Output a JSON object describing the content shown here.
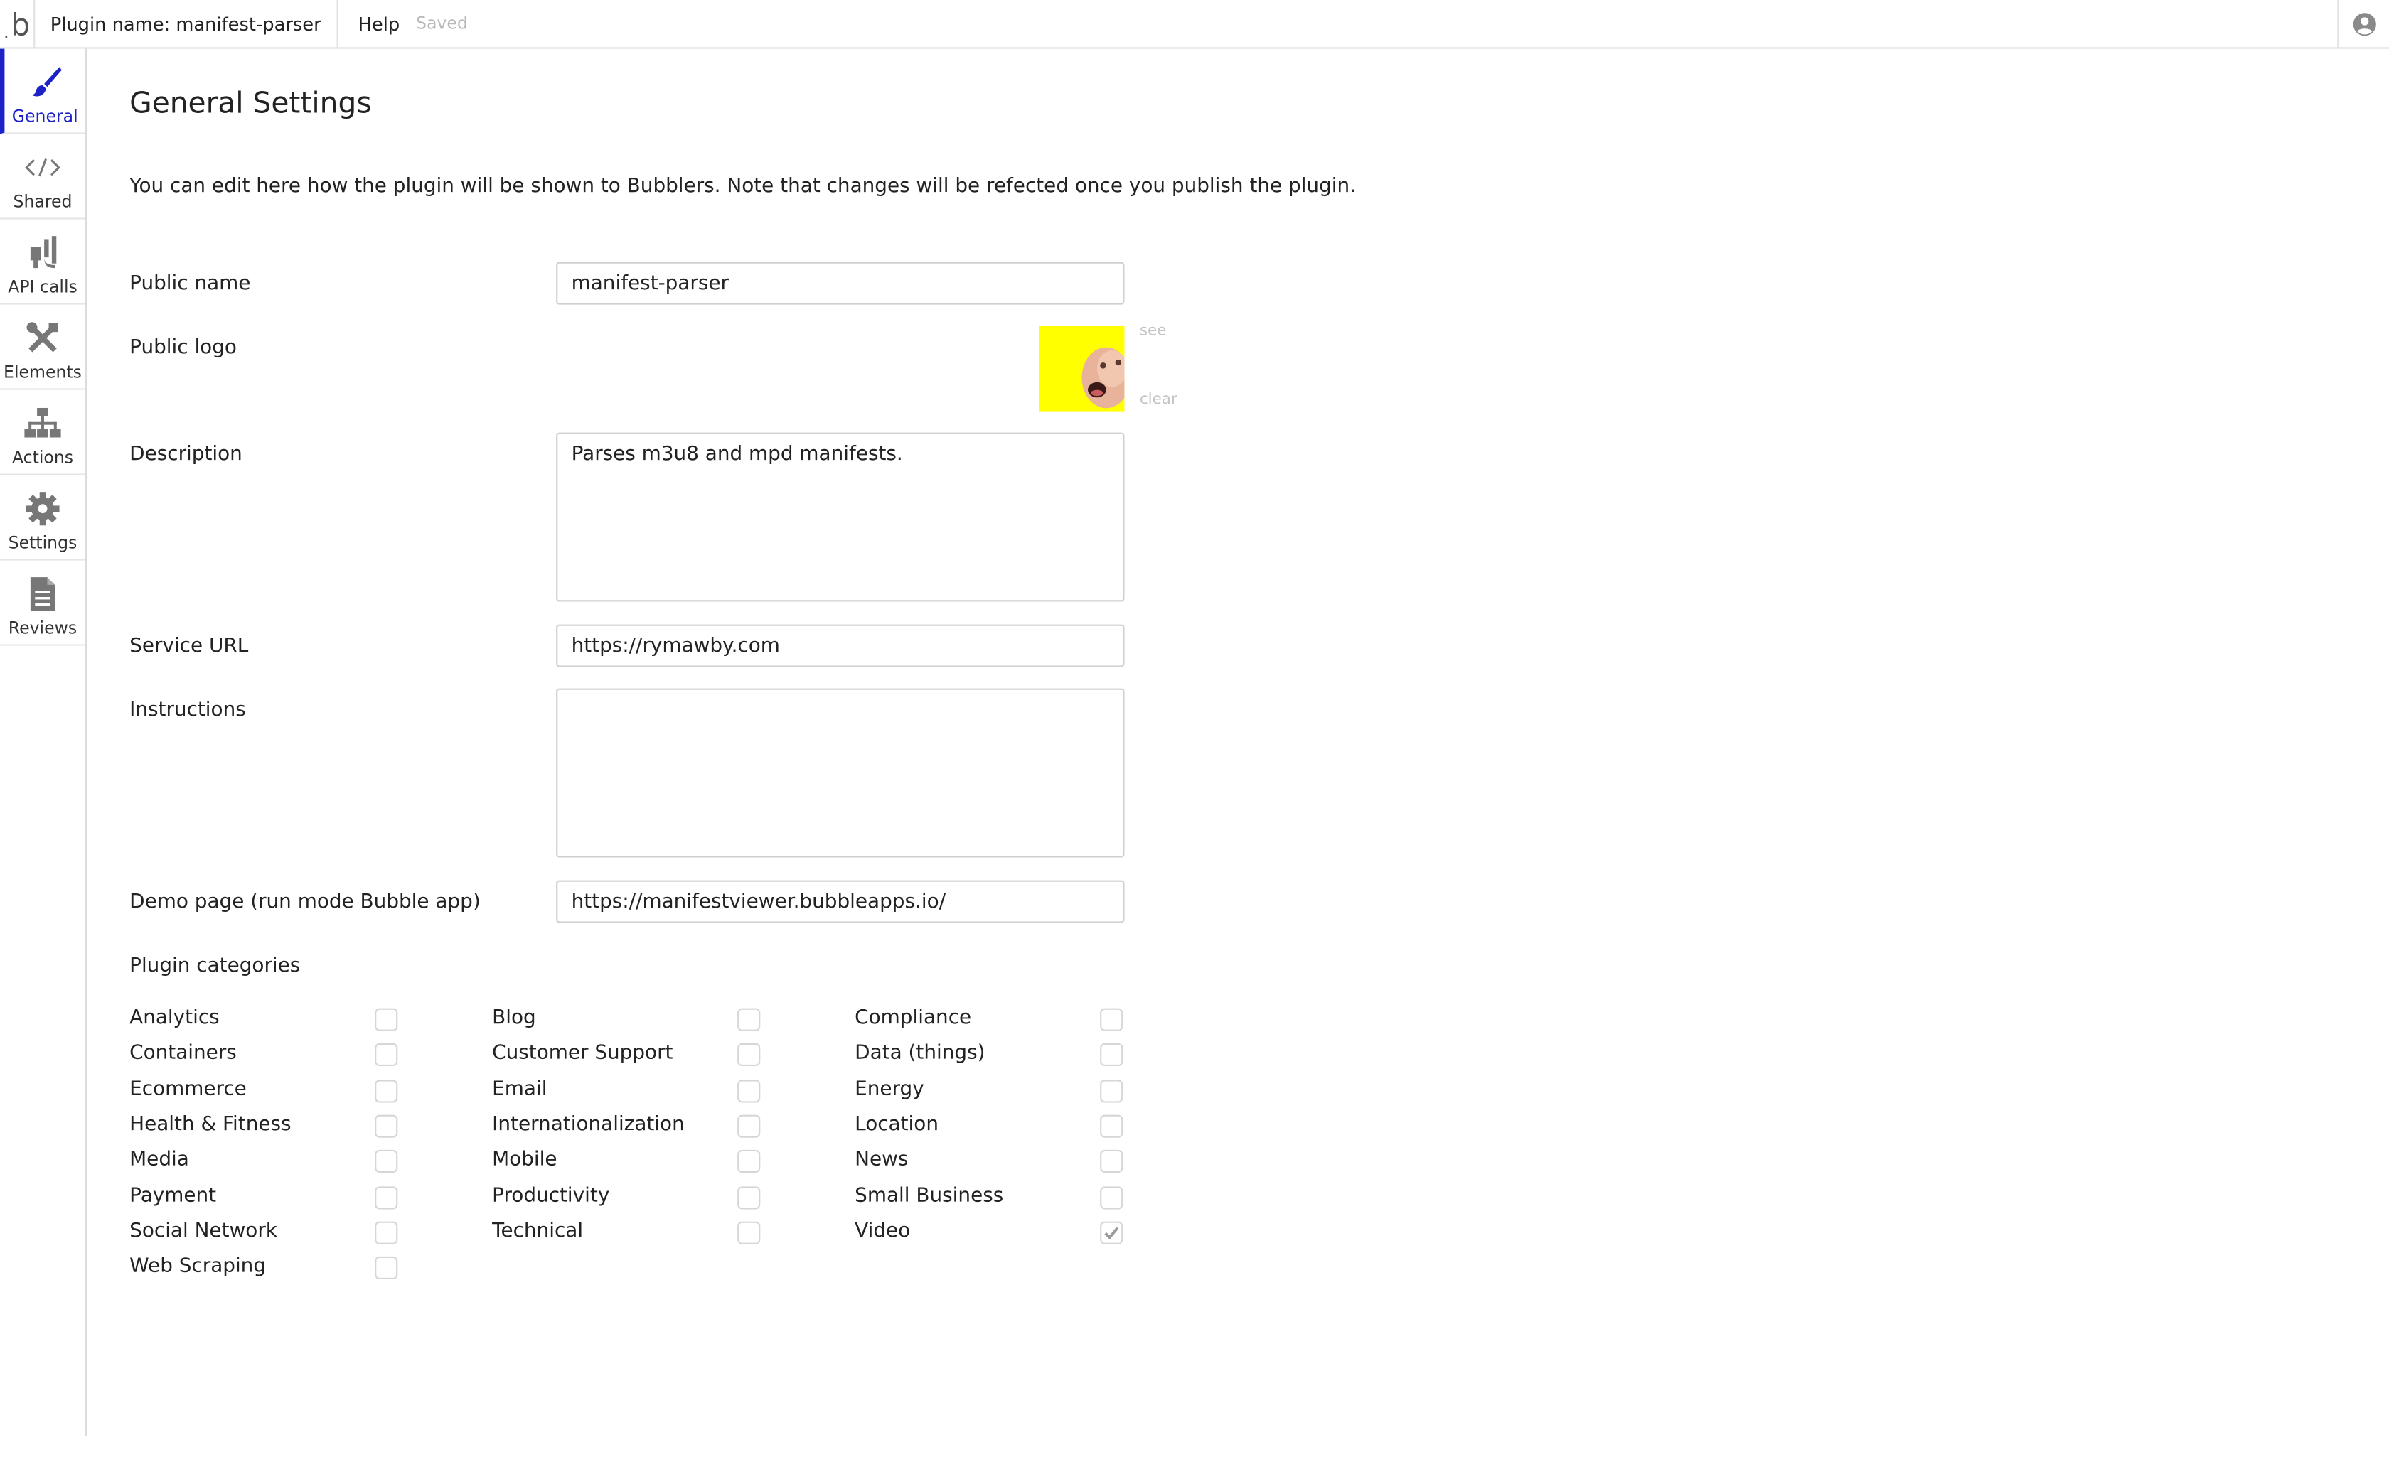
{
  "topbar": {
    "logo_text": "b",
    "plugin_name": "Plugin name: manifest-parser",
    "help": "Help",
    "status": "Saved"
  },
  "sidebar": {
    "items": [
      {
        "label": "General",
        "icon": "brush-icon",
        "active": true
      },
      {
        "label": "Shared",
        "icon": "code-icon",
        "active": false
      },
      {
        "label": "API calls",
        "icon": "plug-icon",
        "active": false
      },
      {
        "label": "Elements",
        "icon": "tools-icon",
        "active": false
      },
      {
        "label": "Actions",
        "icon": "sitemap-icon",
        "active": false
      },
      {
        "label": "Settings",
        "icon": "gear-icon",
        "active": false
      },
      {
        "label": "Reviews",
        "icon": "document-icon",
        "active": false
      }
    ]
  },
  "main": {
    "title": "General Settings",
    "intro": "You can edit here how the plugin will be shown to Bubblers. Note that changes will be refected once you publish the plugin.",
    "fields": {
      "public_name": {
        "label": "Public name",
        "value": "manifest-parser"
      },
      "public_logo": {
        "label": "Public logo",
        "see": "see",
        "clear": "clear"
      },
      "description": {
        "label": "Description",
        "value": "Parses m3u8 and mpd manifests."
      },
      "service_url": {
        "label": "Service URL",
        "value": "https://rymawby.com"
      },
      "instructions": {
        "label": "Instructions",
        "value": ""
      },
      "demo_page": {
        "label": "Demo page (run mode Bubble app)",
        "value": "https://manifestviewer.bubbleapps.io/"
      }
    },
    "categories_heading": "Plugin categories",
    "categories": [
      {
        "label": "Analytics",
        "checked": false
      },
      {
        "label": "Blog",
        "checked": false
      },
      {
        "label": "Compliance",
        "checked": false
      },
      {
        "label": "Containers",
        "checked": false
      },
      {
        "label": "Customer Support",
        "checked": false
      },
      {
        "label": "Data (things)",
        "checked": false
      },
      {
        "label": "Ecommerce",
        "checked": false
      },
      {
        "label": "Email",
        "checked": false
      },
      {
        "label": "Energy",
        "checked": false
      },
      {
        "label": "Health & Fitness",
        "checked": false
      },
      {
        "label": "Internationalization",
        "checked": false
      },
      {
        "label": "Location",
        "checked": false
      },
      {
        "label": "Media",
        "checked": false
      },
      {
        "label": "Mobile",
        "checked": false
      },
      {
        "label": "News",
        "checked": false
      },
      {
        "label": "Payment",
        "checked": false
      },
      {
        "label": "Productivity",
        "checked": false
      },
      {
        "label": "Small Business",
        "checked": false
      },
      {
        "label": "Social Network",
        "checked": false
      },
      {
        "label": "Technical",
        "checked": false
      },
      {
        "label": "Video",
        "checked": true
      },
      {
        "label": "Web Scraping",
        "checked": false
      }
    ]
  },
  "colors": {
    "accent": "#1d21c8",
    "logo_bg": "#ffff00",
    "border": "#cfcfcf",
    "muted": "#c4c4c4"
  }
}
